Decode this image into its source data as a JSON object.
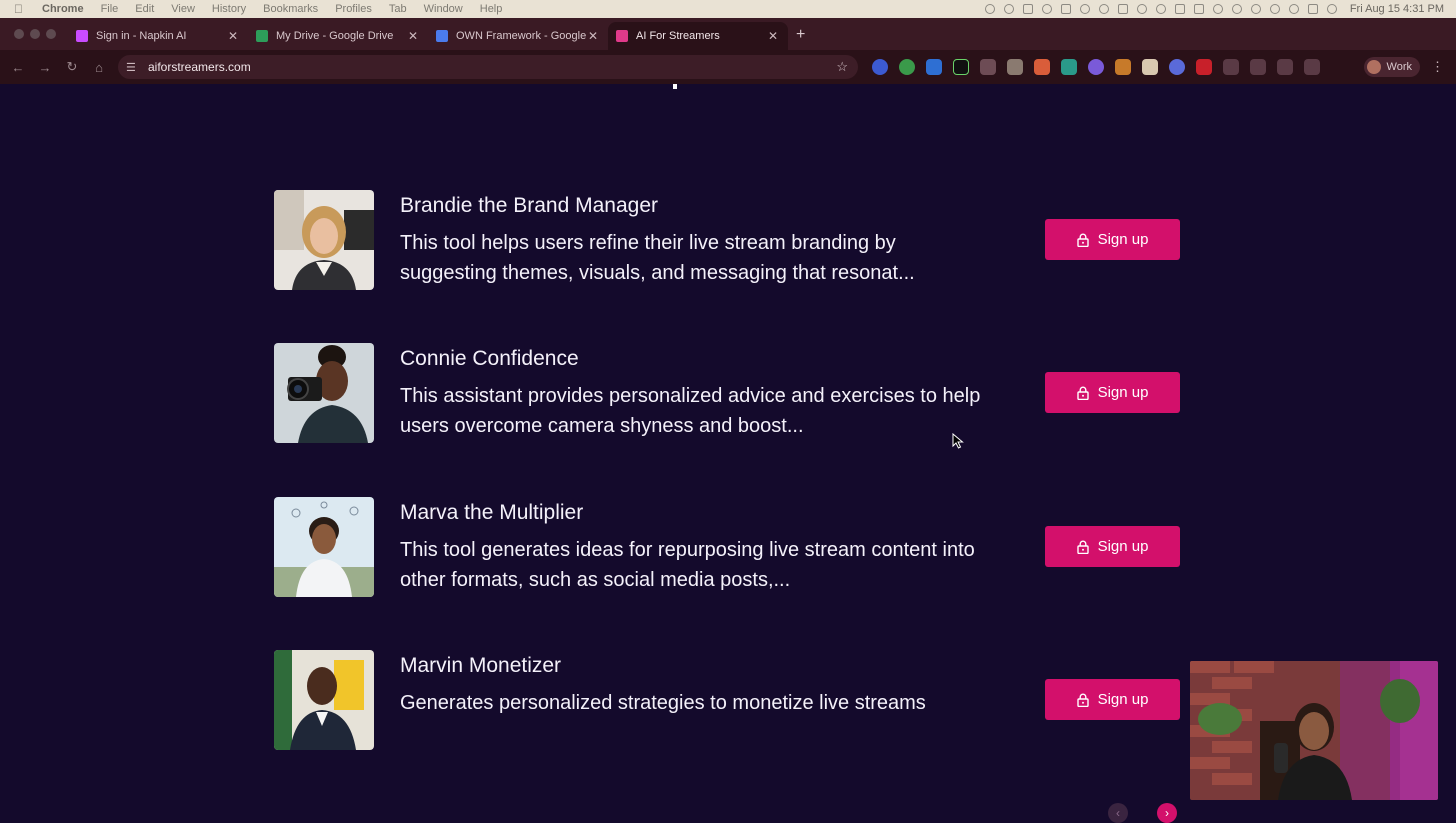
{
  "menubar": {
    "app": "Chrome",
    "items": [
      "File",
      "Edit",
      "View",
      "History",
      "Bookmarks",
      "Profiles",
      "Tab",
      "Window",
      "Help"
    ],
    "clock": "Fri Aug 15  4:31 PM"
  },
  "tabs": [
    {
      "title": "Sign in - Napkin AI",
      "favicon_color": "#c94cff"
    },
    {
      "title": "My Drive - Google Drive",
      "favicon_color": "#2d9d5a"
    },
    {
      "title": "OWN Framework - Google Do",
      "favicon_color": "#4b7bec"
    },
    {
      "title": "AI For Streamers",
      "favicon_color": "#e03a8a"
    }
  ],
  "address_bar": {
    "url": "aiforstreamers.com"
  },
  "profile": {
    "label": "Work"
  },
  "tools": [
    {
      "name": "Brandie the Brand Manager",
      "description": "This tool helps users refine their live stream branding by suggesting themes, visuals, and messaging that resonat...",
      "button": "Sign up"
    },
    {
      "name": "Connie Confidence",
      "description": "This assistant provides personalized advice and exercises to help users overcome camera shyness and boost...",
      "button": "Sign up"
    },
    {
      "name": "Marva the Multiplier",
      "description": "This tool generates ideas for repurposing live stream content into other formats, such as social media posts,...",
      "button": "Sign up"
    },
    {
      "name": "Marvin Monetizer",
      "description": "Generates personalized strategies to monetize live streams",
      "button": "Sign up"
    }
  ],
  "colors": {
    "page_bg": "#140a2c",
    "accent": "#d3106b",
    "text": "#f4f1fa"
  },
  "icons": {
    "lock": "lock-icon",
    "star": "bookmark-star-icon",
    "next": "chevron-right-icon",
    "prev": "chevron-left-icon"
  }
}
